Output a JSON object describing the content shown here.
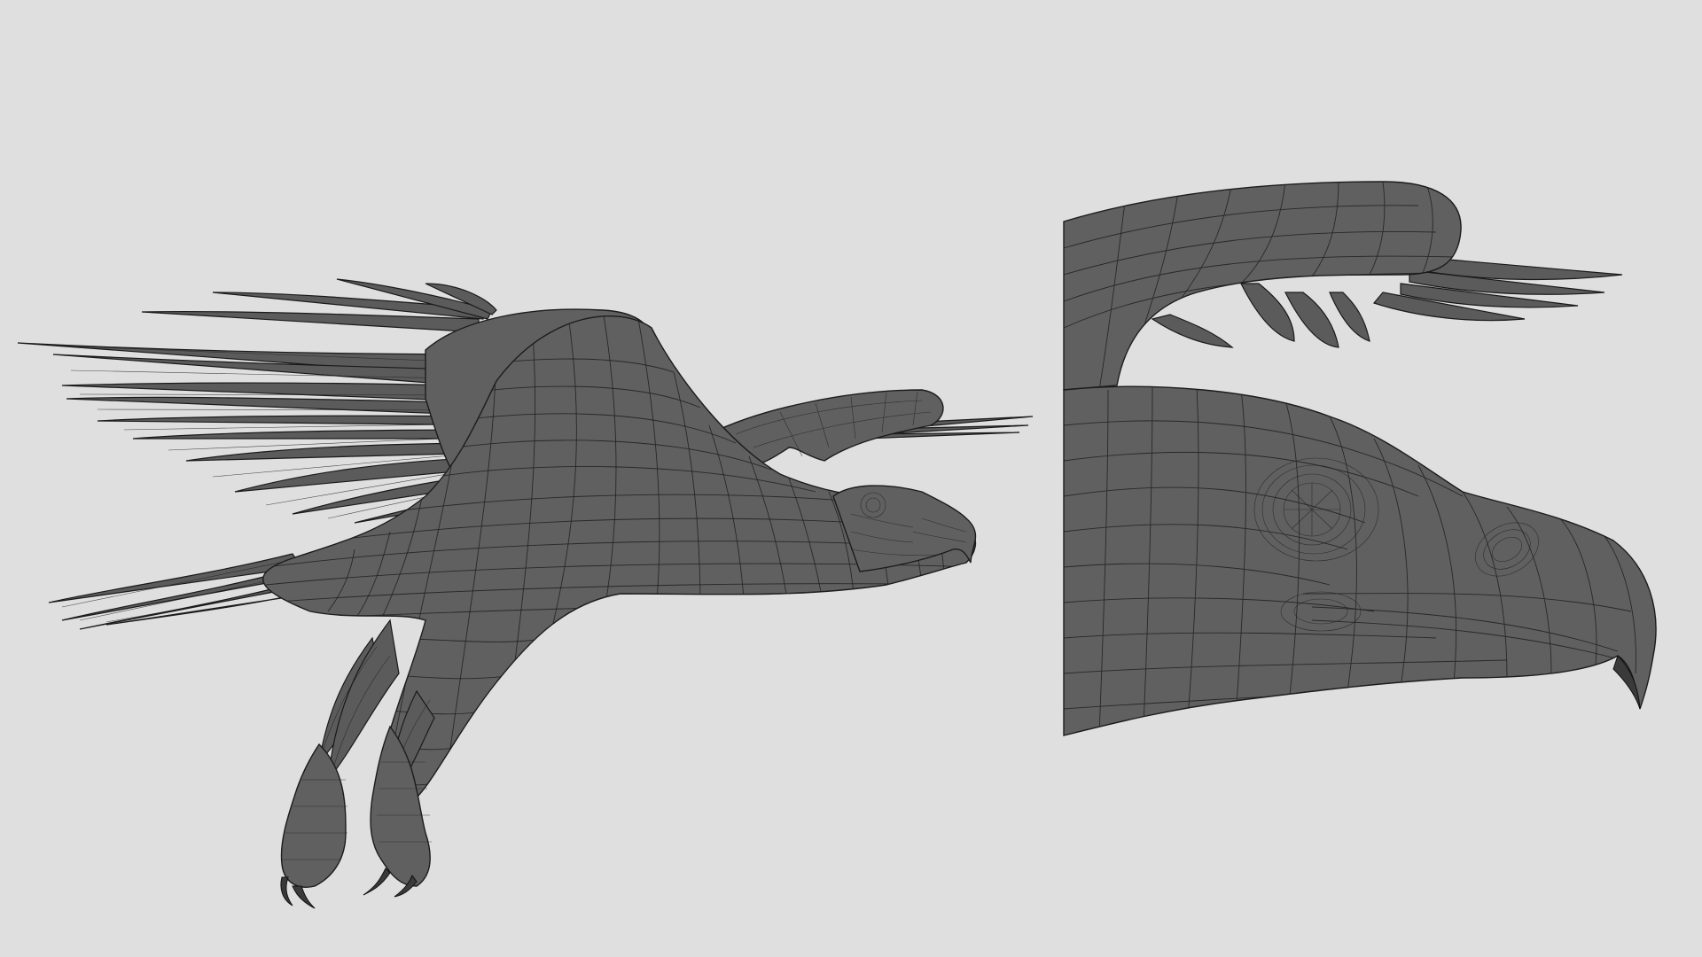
{
  "colors": {
    "background": "#dfdfdf",
    "mesh_fill": "#5f5f5f",
    "mesh_wire": "#1f1f1f"
  },
  "views": [
    {
      "name": "full-body-view",
      "subject": "eagle-wireframe-full"
    },
    {
      "name": "head-closeup-view",
      "subject": "eagle-wireframe-head"
    }
  ]
}
